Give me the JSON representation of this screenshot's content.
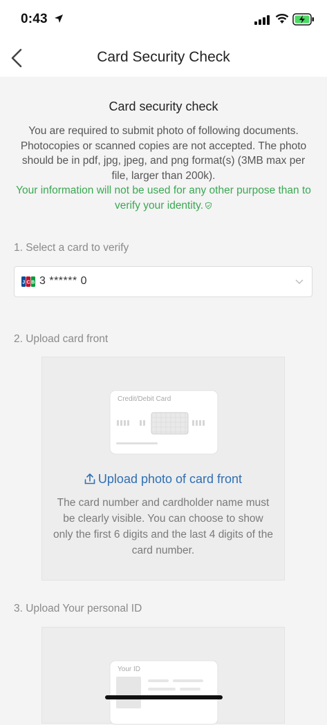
{
  "status_bar": {
    "time": "0:43"
  },
  "nav": {
    "title": "Card Security Check"
  },
  "intro": {
    "heading": "Card security check",
    "description": "You are required to submit photo of following documents. Photocopies or scanned copies are not accepted. The photo should be in pdf, jpg, jpeg, and png format(s) (3MB max per file, larger than 200k).",
    "privacy_note": "Your information will not be used for any other purpose than to verify your identity."
  },
  "step1": {
    "label": "1. Select a card to verify",
    "selected_card": "3 ******  0"
  },
  "step2": {
    "label": "2. Upload card front",
    "card_caption": "Credit/Debit Card",
    "upload_label": "Upload photo of card front",
    "hint": "The card number and cardholder name must be clearly visible. You can choose to show only the first 6 digits and the last 4 digits of the card number."
  },
  "step3": {
    "label": "3. Upload Your personal ID",
    "id_caption": "Your ID"
  },
  "colors": {
    "accent_link": "#2f6fb3",
    "privacy_green": "#3aa853",
    "background": "#f4f4f4"
  }
}
